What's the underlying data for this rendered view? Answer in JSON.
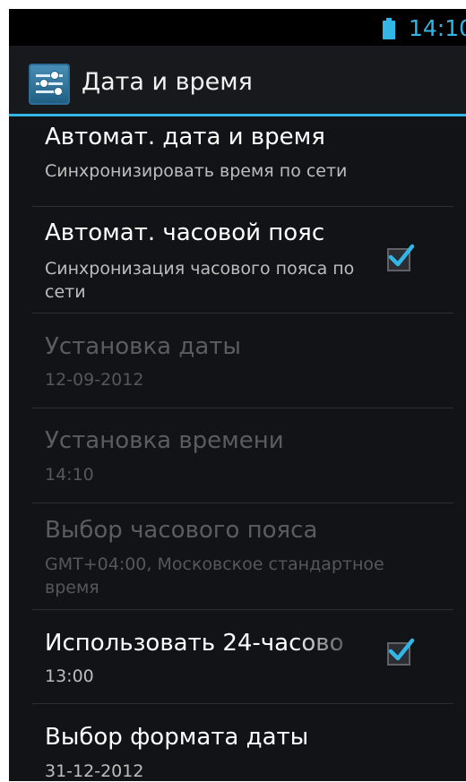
{
  "statusbar": {
    "time": "14:10",
    "battery_icon": "battery-icon",
    "accent": "#33b5e5"
  },
  "actionbar": {
    "title": "Дата и время",
    "icon": "settings-icon"
  },
  "items": [
    {
      "title": "Автомат. дата и время",
      "summary": "Синхронизировать время по сети",
      "enabled": true,
      "checked": false
    },
    {
      "title": "Автомат. часовой пояс",
      "summary": "Синхронизация часового пояса по сети",
      "enabled": true,
      "checked": true
    },
    {
      "title": "Установка даты",
      "summary": "12-09-2012",
      "enabled": false
    },
    {
      "title": "Установка времени",
      "summary": "14:10",
      "enabled": false
    },
    {
      "title": "Выбор часового пояса",
      "summary": "GMT+04:00, Московское стандартное время",
      "enabled": false
    },
    {
      "title": "Использовать 24-часово",
      "summary": "13:00",
      "enabled": true,
      "checked": true
    },
    {
      "title": "Выбор формата даты",
      "summary": "31-12-2012",
      "enabled": true
    }
  ]
}
